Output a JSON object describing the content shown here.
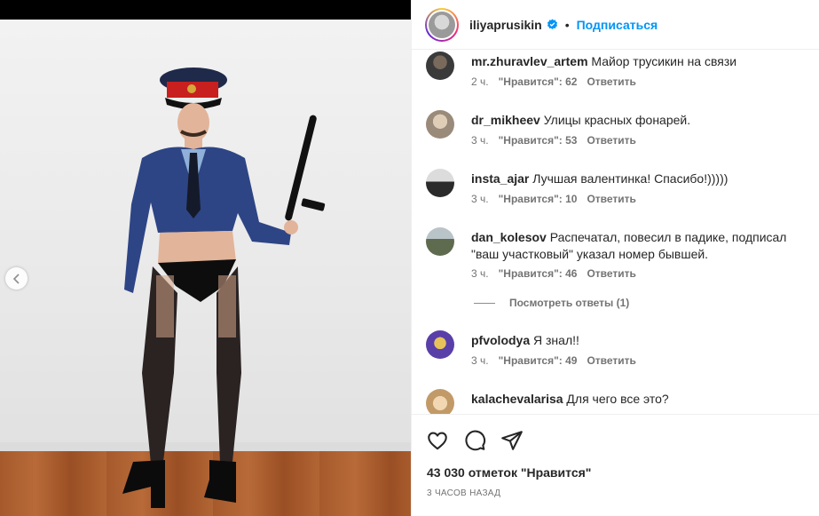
{
  "post": {
    "username": "iliyaprusikin",
    "separator": "•",
    "follow_label": "Подписаться",
    "likes_text": "43 030 отметок \"Нравится\"",
    "timestamp": "3 ЧАСОВ НАЗАД"
  },
  "comments": [
    {
      "user": "mr.zhuravlev_artem",
      "text": "Майор трусикин на связи",
      "time": "2 ч.",
      "likes": "\"Нравится\": 62",
      "reply": "Ответить",
      "avatar_color": "#3a3a3a"
    },
    {
      "user": "dr_mikheev",
      "text": "Улицы красных фонарей.",
      "time": "3 ч.",
      "likes": "\"Нравится\": 53",
      "reply": "Ответить",
      "avatar_color": "#b9a99a"
    },
    {
      "user": "insta_ajar",
      "text": "Лучшая валентинка! Спасибо!)))))",
      "time": "3 ч.",
      "likes": "\"Нравится\": 10",
      "reply": "Ответить",
      "avatar_color": "#4a4a4a"
    },
    {
      "user": "dan_kolesov",
      "text": "Распечатал, повесил в падике, подписал \"ваш участковый\" указал номер бывшей.",
      "time": "3 ч.",
      "likes": "\"Нравится\": 46",
      "reply": "Ответить",
      "avatar_color": "#6b7a6a"
    },
    {
      "user": "pfvolodya",
      "text": "Я знал!!",
      "time": "3 ч.",
      "likes": "\"Нравится\": 49",
      "reply": "Ответить",
      "avatar_color": "#5a3fa8"
    },
    {
      "user": "kalachevalarisa",
      "text": "Для чего все это?",
      "time": "",
      "likes": "",
      "reply": "",
      "avatar_color": "#d9b48a"
    }
  ],
  "view_replies": "Посмотреть ответы (1)",
  "colors": {
    "accent": "#0095f6",
    "text": "#262626",
    "muted": "#737373"
  },
  "icons": [
    "heart-icon",
    "comment-icon",
    "share-icon",
    "verified-icon",
    "chevron-left-icon"
  ]
}
